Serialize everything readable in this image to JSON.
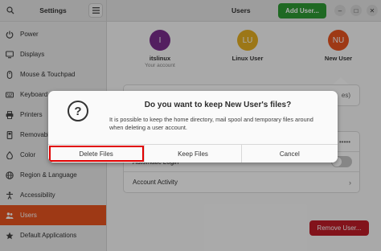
{
  "sidebar": {
    "title": "Settings",
    "items": [
      {
        "label": "Power",
        "icon": "power-icon"
      },
      {
        "label": "Displays",
        "icon": "display-icon"
      },
      {
        "label": "Mouse & Touchpad",
        "icon": "mouse-icon"
      },
      {
        "label": "Keyboard",
        "icon": "keyboard-icon"
      },
      {
        "label": "Printers",
        "icon": "printer-icon"
      },
      {
        "label": "Removable",
        "icon": "removable-media-icon"
      },
      {
        "label": "Color",
        "icon": "color-icon"
      },
      {
        "label": "Region & Language",
        "icon": "region-icon"
      },
      {
        "label": "Accessibility",
        "icon": "accessibility-icon"
      },
      {
        "label": "Users",
        "icon": "users-icon",
        "active": true
      },
      {
        "label": "Default Applications",
        "icon": "star-icon"
      }
    ]
  },
  "header": {
    "title": "Users",
    "add_user_label": "Add User..."
  },
  "users": [
    {
      "initial": "I",
      "name": "itslinux",
      "subtitle": "Your account",
      "color": "#7b2d8e"
    },
    {
      "initial": "LU",
      "name": "Linux User",
      "subtitle": "",
      "color": "#e6b022"
    },
    {
      "initial": "NU",
      "name": "New User",
      "subtitle": "",
      "color": "#e95420"
    }
  ],
  "settings": {
    "row_partial_value": "es)",
    "password_value": "•••••",
    "automatic_login_label": "Automatic Login",
    "account_activity_label": "Account Activity",
    "remove_user_label": "Remove User..."
  },
  "dialog": {
    "title": "Do you want to keep New User's files?",
    "message": "It is possible to keep the home directory, mail spool and temporary files around when deleting a user account.",
    "delete_label": "Delete Files",
    "keep_label": "Keep Files",
    "cancel_label": "Cancel"
  },
  "colors": {
    "accent": "#e95420",
    "add_button": "#2e9b34",
    "remove_button": "#c01c28",
    "highlight": "#e00000"
  }
}
